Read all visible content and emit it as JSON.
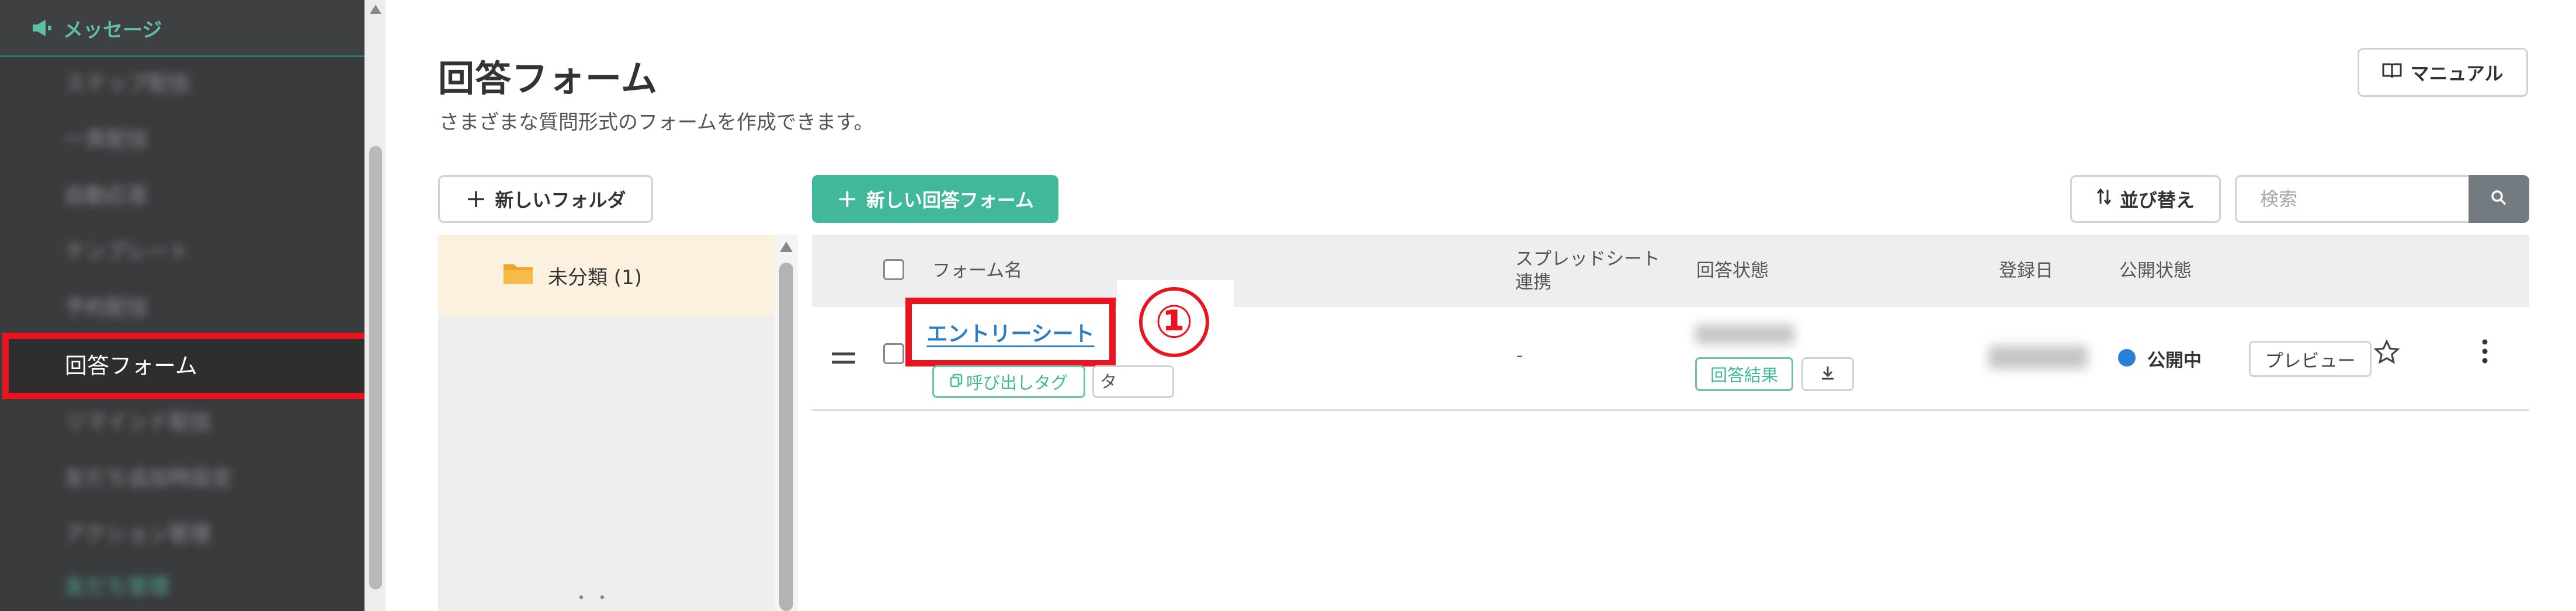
{
  "sidebar": {
    "header_label": "メッセージ",
    "items": [
      {
        "label": "ステップ配信",
        "blurred": true
      },
      {
        "label": "一斉配信",
        "blurred": true
      },
      {
        "label": "自動応答",
        "blurred": true
      },
      {
        "label": "テンプレート",
        "blurred": true
      },
      {
        "label": "予約配信",
        "blurred": true
      },
      {
        "label": "回答フォーム",
        "active": true
      },
      {
        "label": "リマインド配信",
        "blurred": true
      },
      {
        "label": "友だち追加時設定",
        "blurred": true
      },
      {
        "label": "アクション管理",
        "blurred": true
      },
      {
        "label": "友だち管理",
        "blurred": true
      }
    ]
  },
  "header": {
    "title": "回答フォーム",
    "subtitle": "さまざまな質問形式のフォームを作成できます。",
    "manual_label": "マニュアル"
  },
  "toolbar": {
    "new_folder_label": "新しいフォルダ",
    "new_form_label": "新しい回答フォーム",
    "sort_label": "並び替え",
    "search_placeholder": "検索"
  },
  "folders": [
    {
      "label": "未分類 (1)"
    }
  ],
  "folder_footer": "・・",
  "table": {
    "columns": {
      "name": "フォーム名",
      "spreadsheet": "スプレッドシート連携",
      "answer_status": "回答状態",
      "registered": "登録日",
      "publish_status": "公開状態"
    },
    "rows": [
      {
        "name": "エントリーシート",
        "call_tag": "呼び出しタグ",
        "tag_chip": "タ",
        "spreadsheet": "-",
        "result_label": "回答結果",
        "publish_status": "公開中",
        "preview_label": "プレビュー"
      }
    ]
  },
  "annotation": {
    "number": "①",
    "color": "#e8141f"
  },
  "colors": {
    "accent": "#42b89b",
    "sidebar_bg": "#3a3b3d",
    "link": "#2b7fc1",
    "status_public": "#2a80d8"
  }
}
